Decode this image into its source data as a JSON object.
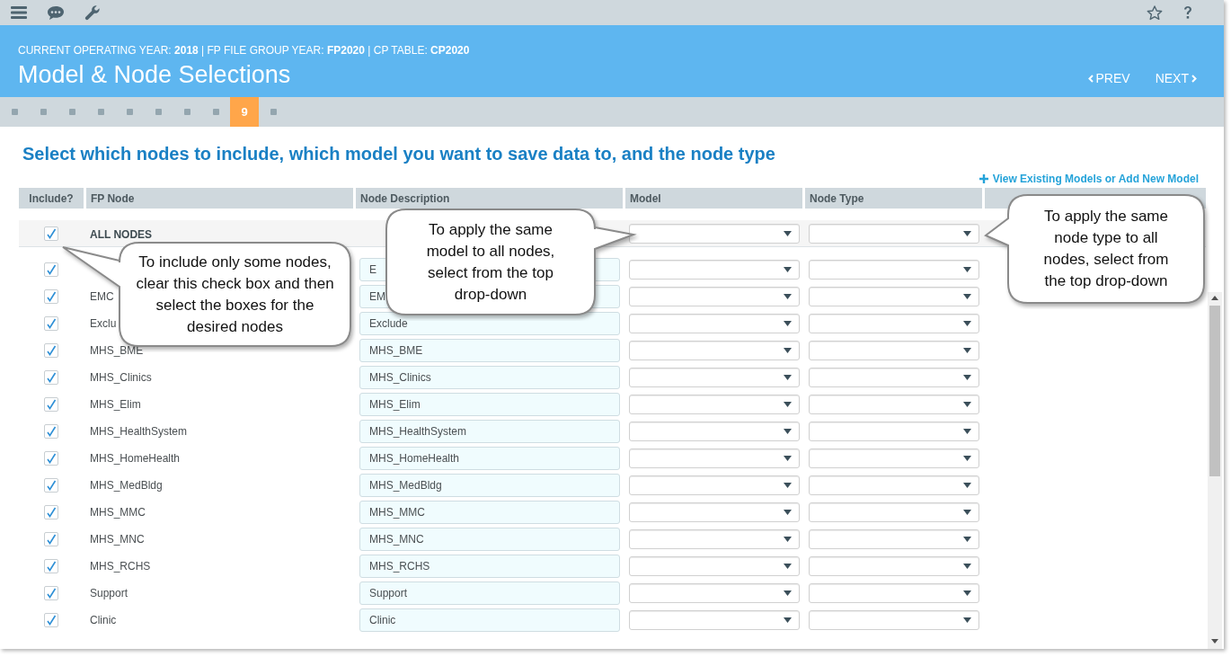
{
  "header": {
    "context": "CURRENT OPERATING YEAR: **2018** | FP FILE GROUP YEAR: **FP2020** | CP TABLE: **CP2020**",
    "title": "Model & Node Selections",
    "prev": "PREV",
    "next": "NEXT"
  },
  "steps": [
    {
      "selected": false
    },
    {
      "selected": false
    },
    {
      "selected": false
    },
    {
      "selected": false
    },
    {
      "selected": false
    },
    {
      "selected": false
    },
    {
      "selected": false
    },
    {
      "selected": false
    },
    {
      "label": "9",
      "selected": true
    },
    {
      "selected": false
    }
  ],
  "heading": "Select which nodes to include, which model you want to save data to, and the node type",
  "add_link": "View Existing Models or Add New Model",
  "table": {
    "columns": [
      "Include?",
      "FP Node",
      "Node Description",
      "Model",
      "Node Type"
    ],
    "all_row": {
      "label": "ALL NODES",
      "checked": true
    },
    "rows": [
      {
        "description": "E",
        "checked": true
      },
      {
        "node": "EMC",
        "description": "EM",
        "checked": true
      },
      {
        "node": "Exclu",
        "description": "Exclude",
        "checked": true
      },
      {
        "node": "MHS_BME",
        "description": "MHS_BME",
        "checked": true
      },
      {
        "node": "MHS_Clinics",
        "description": "MHS_Clinics",
        "checked": true
      },
      {
        "node": "MHS_Elim",
        "description": "MHS_Elim",
        "checked": true
      },
      {
        "node": "MHS_HealthSystem",
        "description": "MHS_HealthSystem",
        "checked": true
      },
      {
        "node": "MHS_HomeHealth",
        "description": "MHS_HomeHealth",
        "checked": true
      },
      {
        "node": "MHS_MedBldg",
        "description": "MHS_MedBldg",
        "checked": true
      },
      {
        "node": "MHS_MMC",
        "description": "MHS_MMC",
        "checked": true
      },
      {
        "node": "MHS_MNC",
        "description": "MHS_MNC",
        "checked": true
      },
      {
        "node": "MHS_RCHS",
        "description": "MHS_RCHS",
        "checked": true
      },
      {
        "node": "Support",
        "description": "Support",
        "checked": true
      },
      {
        "node": "Clinic",
        "description": "Clinic",
        "checked": true
      }
    ]
  },
  "callouts": [
    {
      "text": "To include only some nodes, clear this check box and then select the boxes for the desired nodes"
    },
    {
      "text": "To apply the same model to all nodes, select from the top drop-down"
    },
    {
      "text": "To apply the same node type to all nodes, select from the top drop-down"
    }
  ]
}
